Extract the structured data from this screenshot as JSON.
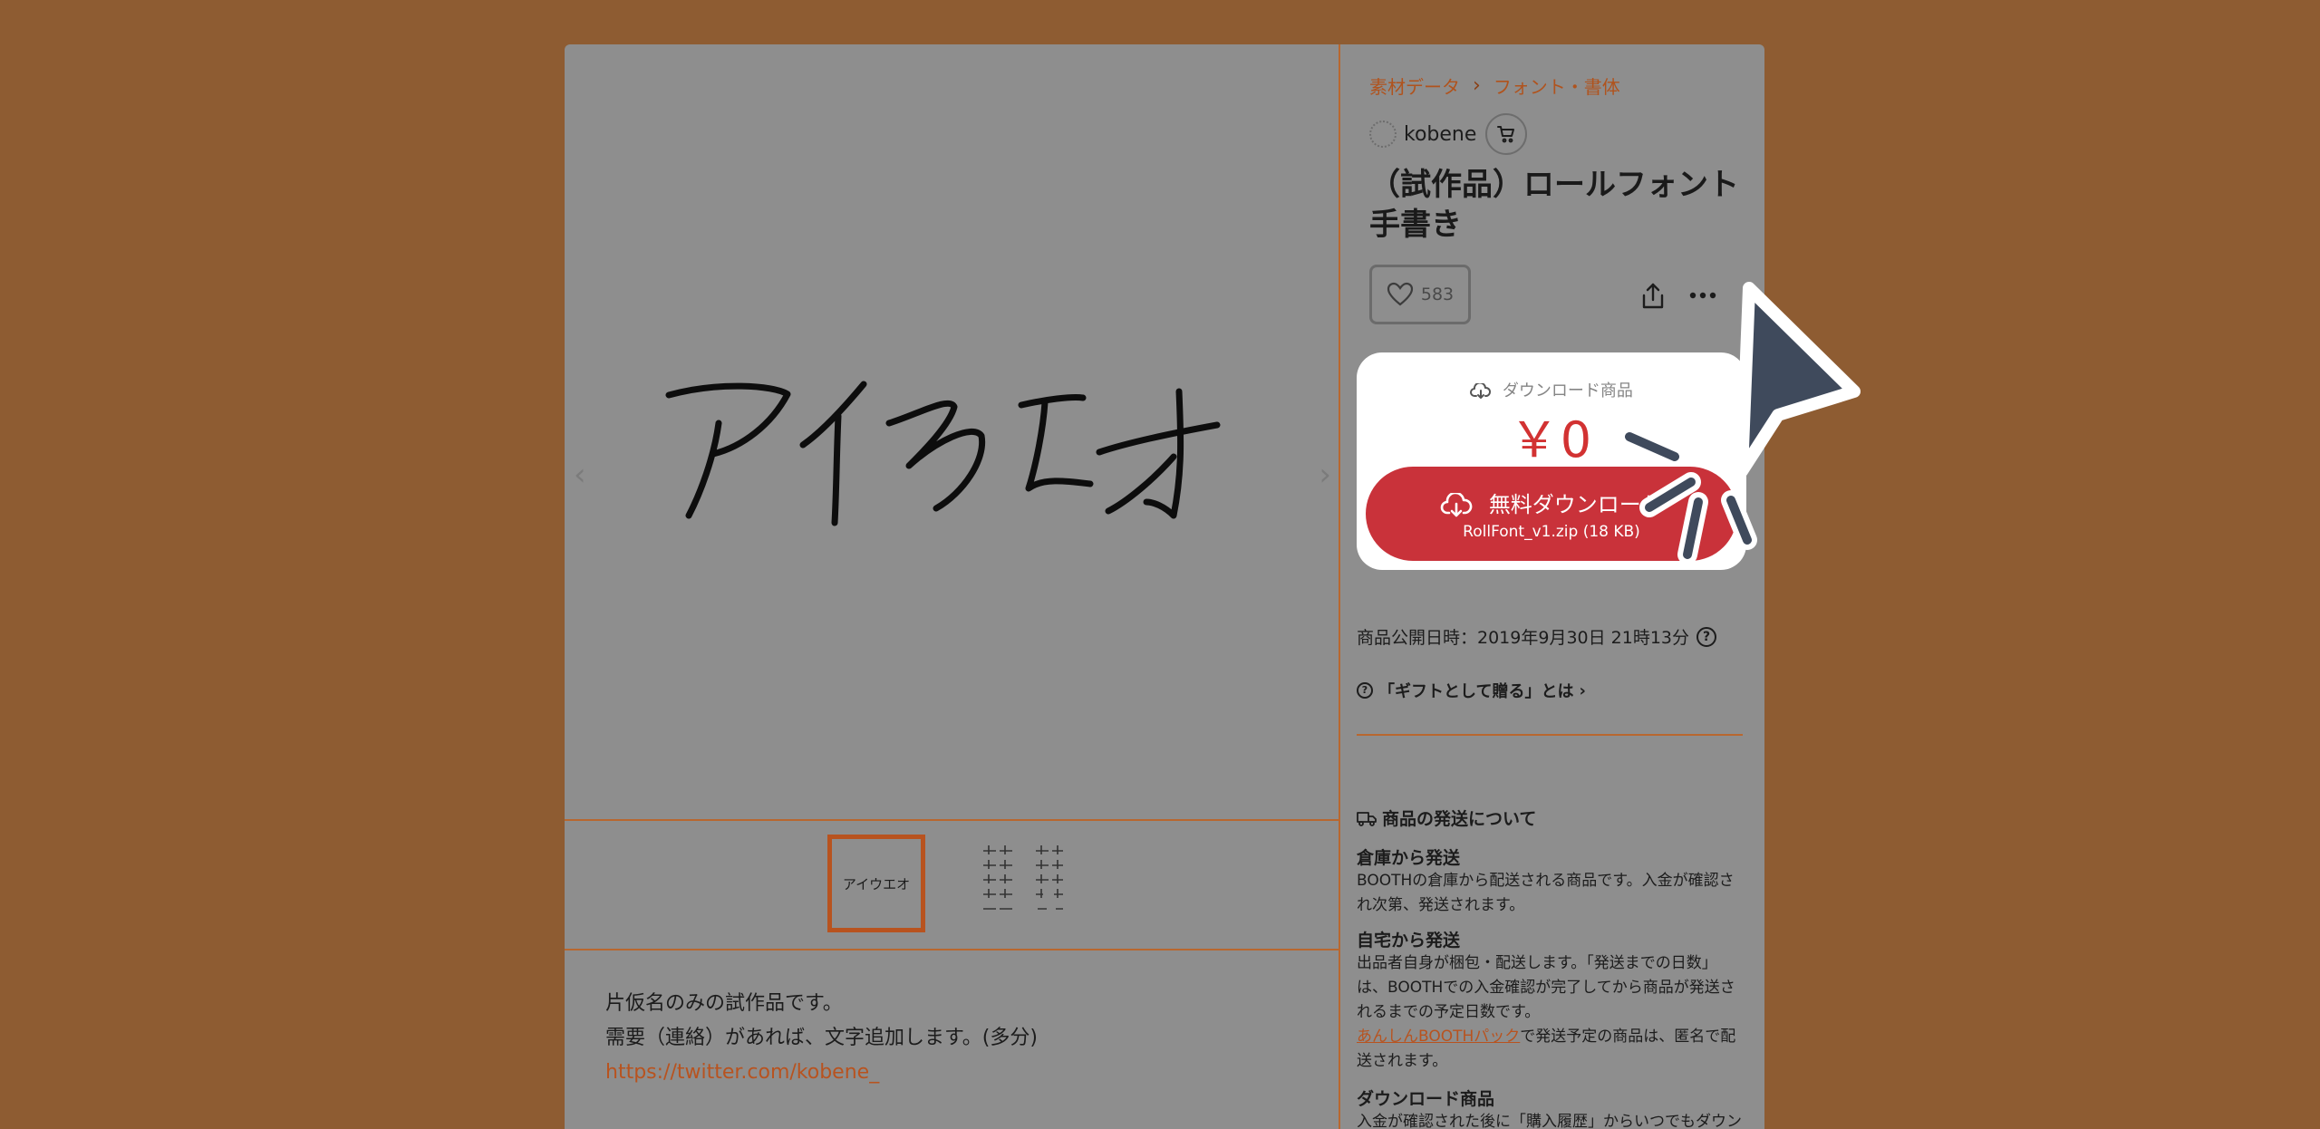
{
  "breadcrumb": {
    "items": [
      "素材データ",
      "フォント・書体"
    ],
    "separator": "›"
  },
  "shop": {
    "name": "kobene"
  },
  "product": {
    "title": "（試作品）ロールフォント手書き",
    "likes": "583",
    "image_text": "アイウエオ",
    "thumbnail_1_text": "アイウエオ",
    "thumbnail_2_text": "ウエオ カキク\nズセソ タチツ\nスネノ ハヒフ\nムメモ ヤ ユ\nレレロ ワ ヲ"
  },
  "purchase": {
    "type_label": "ダウンロード商品",
    "price": "￥0",
    "button_label": "無料ダウンロード",
    "file": "RollFont_v1.zip (18 KB)"
  },
  "info": {
    "published_label": "商品公開日時：2019年9月30日 21時13分",
    "gift_label": "「ギフトとして贈る」とは",
    "shipping_title": "商品の発送について",
    "warehouse_title": "倉庫から発送",
    "warehouse_text": "BOOTHの倉庫から配送される商品です。入金が確認され次第、発送されます。",
    "home_title": "自宅から発送",
    "home_text": "出品者自身が梱包・配送します。「発送までの日数」は、BOOTHでの入金確認が完了してから商品が発送されるまでの予定日数です。",
    "anshin_link": "あんしんBOOTHパック",
    "anshin_text": "で発送予定の商品は、匿名で配送されます。",
    "download_title": "ダウンロード商品",
    "download_text": "入金が確認された後に「購入履歴」からいつでもダウンロードできるようになります。"
  },
  "description": {
    "line1": "片仮名のみの試作品です。",
    "line2": "需要（連絡）があれば、文字追加します。(多分)",
    "link": "https://twitter.com/kobene_"
  },
  "nav": {
    "prev": "‹",
    "next": "›"
  },
  "colors": {
    "page_bg": "#8e5c32",
    "accent": "#b8531f",
    "price_red": "#d23232",
    "button_red": "#c9323a"
  }
}
